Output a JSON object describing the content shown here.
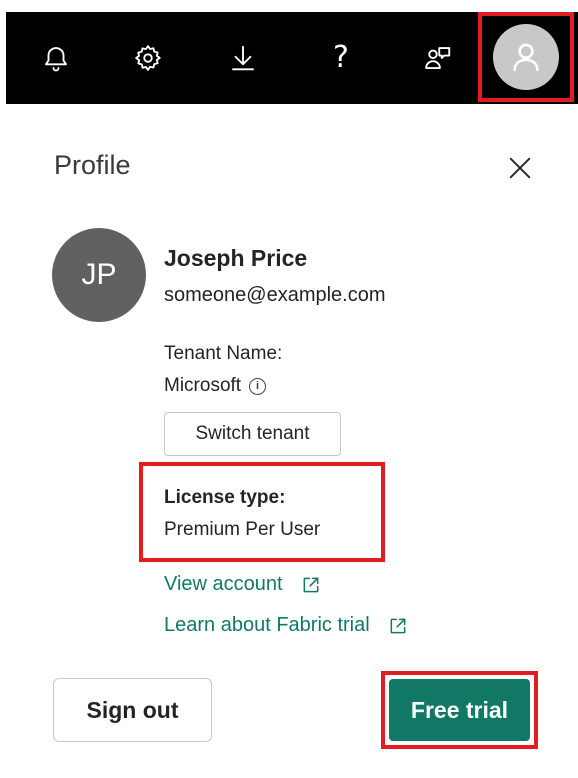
{
  "topbar": {
    "icons": [
      "bell-icon",
      "gear-icon",
      "download-icon",
      "help-icon",
      "feedback-icon",
      "account-icon"
    ],
    "help_glyph": "?",
    "background": "#000000"
  },
  "panel": {
    "title": "Profile",
    "close_icon": "close-icon"
  },
  "user": {
    "initials": "JP",
    "name": "Joseph Price",
    "email": "someone@example.com"
  },
  "tenant": {
    "label": "Tenant Name:",
    "value": "Microsoft",
    "info_icon": "info-icon",
    "info_glyph": "i",
    "switch_label": "Switch tenant"
  },
  "license": {
    "label": "License type:",
    "value": "Premium Per User"
  },
  "links": {
    "view_account": "View account",
    "learn_fabric": "Learn about Fabric trial"
  },
  "actions": {
    "sign_out": "Sign out",
    "free_trial": "Free trial"
  },
  "colors": {
    "accent": "#117865",
    "highlight": "#e31b23",
    "avatar_bg": "#616161"
  }
}
